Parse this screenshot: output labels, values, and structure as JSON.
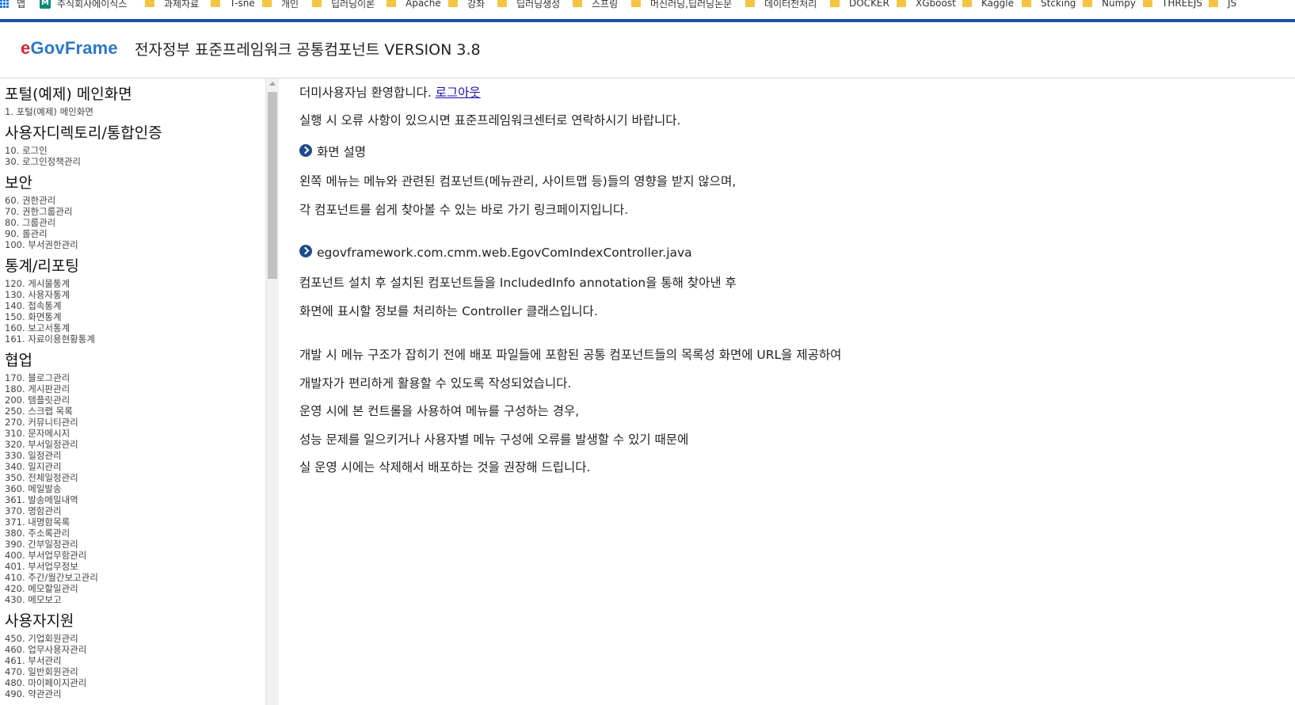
{
  "bookmarks": [
    {
      "label": "앱",
      "icon": "apps-grid-icon"
    },
    {
      "label": "주식회사에이식스",
      "icon": "m-logo-icon"
    },
    {
      "label": "과제자료",
      "icon": "folder-icon"
    },
    {
      "label": "T-sne",
      "icon": "folder-icon"
    },
    {
      "label": "개인",
      "icon": "folder-icon"
    },
    {
      "label": "딥러닝이론",
      "icon": "folder-icon"
    },
    {
      "label": "Apache",
      "icon": "folder-icon"
    },
    {
      "label": "강좌",
      "icon": "folder-icon"
    },
    {
      "label": "딥러닝생성",
      "icon": "folder-icon"
    },
    {
      "label": "스프링",
      "icon": "folder-icon"
    },
    {
      "label": "머신러닝,딥러닝논문",
      "icon": "folder-icon"
    },
    {
      "label": "데이터전처리",
      "icon": "folder-icon"
    },
    {
      "label": "DOCKER",
      "icon": "folder-icon"
    },
    {
      "label": "XGboost",
      "icon": "folder-icon"
    },
    {
      "label": "Kaggle",
      "icon": "folder-icon"
    },
    {
      "label": "Stcking",
      "icon": "folder-icon"
    },
    {
      "label": "Numpy",
      "icon": "folder-icon"
    },
    {
      "label": "THREEJS",
      "icon": "folder-icon"
    },
    {
      "label": "JS",
      "icon": "folder-icon"
    }
  ],
  "header": {
    "logo_e": "e",
    "logo_rest": "GovFrame",
    "title": "전자정부 표준프레임워크 공통컴포넌트 VERSION 3.8"
  },
  "sidebar": {
    "sections": [
      {
        "title": "포털(예제) 메인화면",
        "items": [
          "1. 포털(예제) 메인화면"
        ]
      },
      {
        "title": "사용자디렉토리/통합인증",
        "items": [
          "10. 로그인",
          "30. 로그인정책관리"
        ]
      },
      {
        "title": "보안",
        "items": [
          "60. 권한관리",
          "70. 권한그룹관리",
          "80. 그룹관리",
          "90. 롤관리",
          "100. 부서권한관리"
        ]
      },
      {
        "title": "통계/리포팅",
        "items": [
          "120. 게시물통계",
          "130. 사용자통계",
          "140. 접속통계",
          "150. 화면통계",
          "160. 보고서통계",
          "161. 자료이용현황통계"
        ]
      },
      {
        "title": "협업",
        "items": [
          "170. 블로그관리",
          "180. 게시판관리",
          "200. 템플릿관리",
          "250. 스크랩 목록",
          "270. 커뮤니티관리",
          "310. 문자메시지",
          "320. 부서일정관리",
          "330. 일정관리",
          "340. 일지관리",
          "350. 전체일정관리",
          "360. 메일발송",
          "361. 발송메일내역",
          "370. 명함관리",
          "371. 내명함목록",
          "380. 주소록관리",
          "390. 간부일정관리",
          "400. 부서업무함관리",
          "401. 부서업무정보",
          "410. 주간/월간보고관리",
          "420. 메모할일관리",
          "430. 메모보고"
        ]
      },
      {
        "title": "사용자지원",
        "items": [
          "450. 기업회원관리",
          "460. 업무사용자관리",
          "461. 부서관리",
          "470. 일반회원관리",
          "480. 마이페이지관리",
          "490. 약관관리"
        ]
      }
    ]
  },
  "main": {
    "welcome_text": "더미사용자님 환영합니다.",
    "logout_link": "로그아웃",
    "notice": "실행 시 오류 사항이 있으시면 표준프레임워크센터로 연락하시기 바랍니다.",
    "section1_title": "화면 설명",
    "section1_lines": [
      "왼쪽 메뉴는 메뉴와 관련된 컴포넌트(메뉴관리, 사이트맵 등)들의 영향을 받지 않으며,",
      "각 컴포넌트를 쉽게 찾아볼 수 있는 바로 가기 링크페이지입니다."
    ],
    "section2_title": "egovframework.com.cmm.web.EgovComIndexController.java",
    "section2_lines": [
      "컴포넌트 설치 후 설치된 컴포넌트들을 IncludedInfo annotation을 통해 찾아낸 후",
      "화면에 표시할 정보를 처리하는 Controller 클래스입니다.",
      "개발 시 메뉴 구조가 잡히기 전에 배포 파일들에 포함된 공통 컴포넌트들의 목록성 화면에 URL을 제공하여",
      "개발자가 편리하게 활용할 수 있도록 작성되었습니다.",
      "운영 시에 본 컨트롤을 사용하여 메뉴를 구성하는 경우,",
      "성능 문제를 일으키거나 사용자별 메뉴 구성에 오류를 발생할 수 있기 때문에",
      "실 운영 시에는 삭제해서 배포하는 것을 권장해 드립니다."
    ]
  }
}
